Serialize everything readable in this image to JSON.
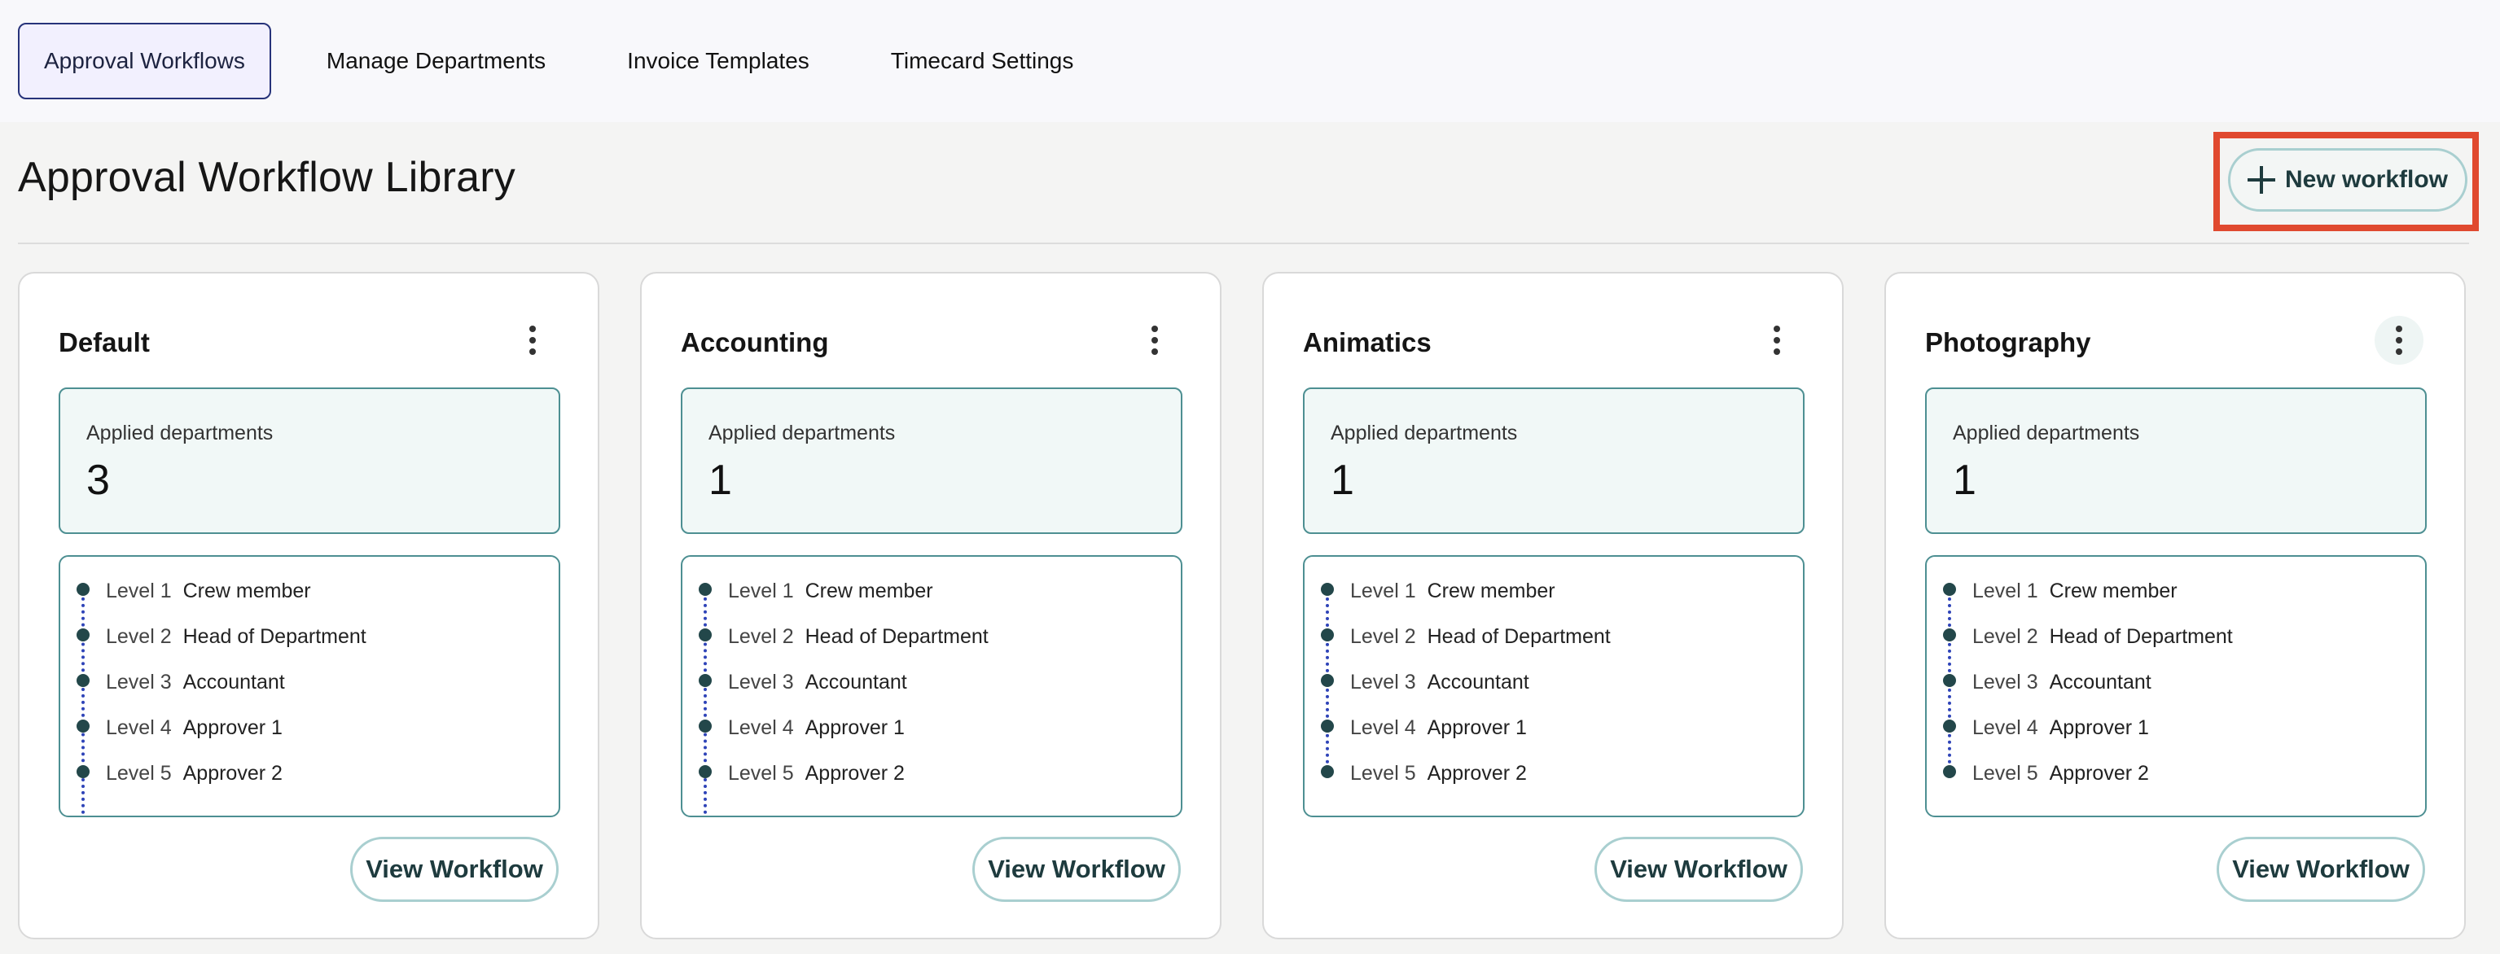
{
  "tabs": [
    {
      "label": "Approval Workflows",
      "active": true
    },
    {
      "label": "Manage Departments",
      "active": false
    },
    {
      "label": "Invoice Templates",
      "active": false
    },
    {
      "label": "Timecard Settings",
      "active": false
    }
  ],
  "header": {
    "title": "Approval Workflow Library",
    "new_workflow_label": "New workflow"
  },
  "cards": [
    {
      "name": "Default",
      "applied_label": "Applied departments",
      "applied_count": "3",
      "levels": [
        {
          "level": "Level 1",
          "role": "Crew member"
        },
        {
          "level": "Level 2",
          "role": "Head of Department"
        },
        {
          "level": "Level 3",
          "role": "Accountant"
        },
        {
          "level": "Level 4",
          "role": "Approver 1"
        },
        {
          "level": "Level 5",
          "role": "Approver 2"
        }
      ],
      "view_label": "View Workflow"
    },
    {
      "name": "Accounting",
      "applied_label": "Applied departments",
      "applied_count": "1",
      "levels": [
        {
          "level": "Level 1",
          "role": "Crew member"
        },
        {
          "level": "Level 2",
          "role": "Head of Department"
        },
        {
          "level": "Level 3",
          "role": "Accountant"
        },
        {
          "level": "Level 4",
          "role": "Approver 1"
        },
        {
          "level": "Level 5",
          "role": "Approver 2"
        }
      ],
      "view_label": "View Workflow"
    },
    {
      "name": "Animatics",
      "applied_label": "Applied departments",
      "applied_count": "1",
      "levels": [
        {
          "level": "Level 1",
          "role": "Crew member"
        },
        {
          "level": "Level 2",
          "role": "Head of Department"
        },
        {
          "level": "Level 3",
          "role": "Accountant"
        },
        {
          "level": "Level 4",
          "role": "Approver 1"
        },
        {
          "level": "Level 5",
          "role": "Approver 2"
        }
      ],
      "view_label": "View Workflow"
    },
    {
      "name": "Photography",
      "applied_label": "Applied departments",
      "applied_count": "1",
      "levels": [
        {
          "level": "Level 1",
          "role": "Crew member"
        },
        {
          "level": "Level 2",
          "role": "Head of Department"
        },
        {
          "level": "Level 3",
          "role": "Accountant"
        },
        {
          "level": "Level 4",
          "role": "Approver 1"
        },
        {
          "level": "Level 5",
          "role": "Approver 2"
        }
      ],
      "view_label": "View Workflow"
    }
  ],
  "icons": {
    "new_workflow": "plus-icon",
    "card_menu": "more-vertical-icon"
  },
  "colors": {
    "accent": "#4d8f92",
    "button_border": "#a9cfd0",
    "active_tab_border": "#27337a",
    "highlight": "#e0492f",
    "timeline_dot": "#23474a",
    "timeline_line": "#2f44b8"
  }
}
